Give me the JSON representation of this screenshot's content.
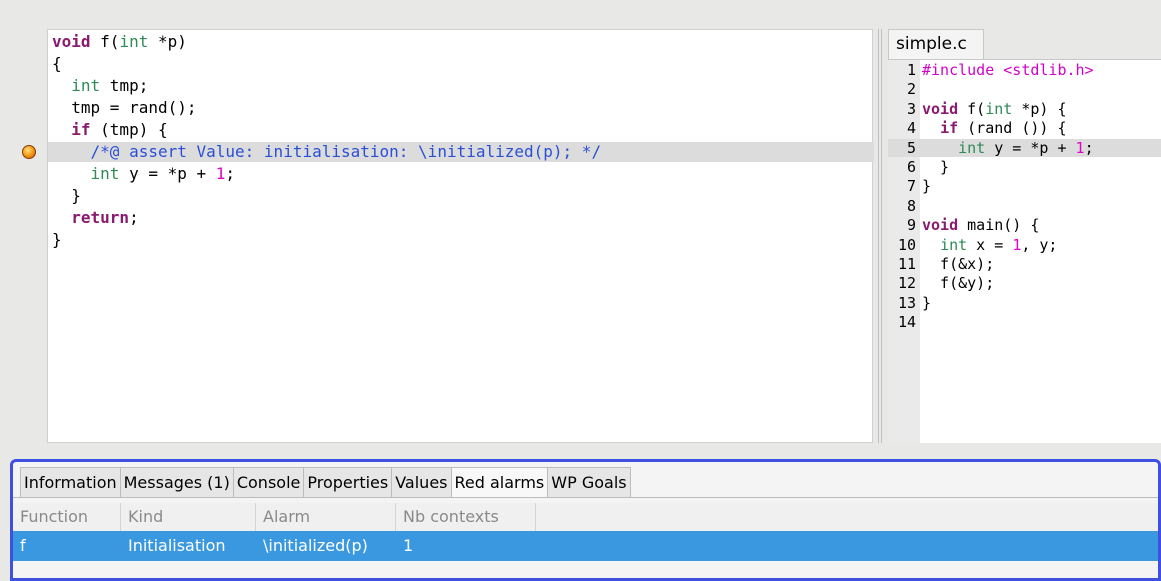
{
  "code_view": {
    "lines": [
      {
        "segments": [
          {
            "t": "void",
            "c": "kw"
          },
          {
            "t": " f(",
            "c": ""
          },
          {
            "t": "int",
            "c": "type"
          },
          {
            "t": " *p)",
            "c": ""
          }
        ]
      },
      {
        "segments": [
          {
            "t": "{",
            "c": ""
          }
        ]
      },
      {
        "segments": [
          {
            "t": "  ",
            "c": ""
          },
          {
            "t": "int",
            "c": "type"
          },
          {
            "t": " tmp;",
            "c": ""
          }
        ]
      },
      {
        "segments": [
          {
            "t": "  tmp = rand();",
            "c": ""
          }
        ]
      },
      {
        "segments": [
          {
            "t": "  ",
            "c": ""
          },
          {
            "t": "if",
            "c": "kw"
          },
          {
            "t": " (tmp) {",
            "c": ""
          }
        ]
      },
      {
        "segments": [
          {
            "t": "    /*@ assert Value: initialisation: \\initialized(p); */",
            "c": "comment"
          }
        ],
        "highlight": true,
        "alarm": true
      },
      {
        "segments": [
          {
            "t": "    ",
            "c": ""
          },
          {
            "t": "int",
            "c": "type"
          },
          {
            "t": " y = *p + ",
            "c": ""
          },
          {
            "t": "1",
            "c": "num"
          },
          {
            "t": ";",
            "c": ""
          }
        ]
      },
      {
        "segments": [
          {
            "t": "  }",
            "c": ""
          }
        ]
      },
      {
        "segments": [
          {
            "t": "  ",
            "c": ""
          },
          {
            "t": "return",
            "c": "kw"
          },
          {
            "t": ";",
            "c": ""
          }
        ]
      },
      {
        "segments": [
          {
            "t": "}",
            "c": ""
          }
        ]
      }
    ]
  },
  "source_view": {
    "tab_label": "simple.c",
    "lines": [
      {
        "n": "1",
        "segments": [
          {
            "t": "#include <stdlib.h>",
            "c": "pre"
          }
        ]
      },
      {
        "n": "2",
        "segments": []
      },
      {
        "n": "3",
        "segments": [
          {
            "t": "void",
            "c": "kw"
          },
          {
            "t": " f(",
            "c": ""
          },
          {
            "t": "int",
            "c": "type"
          },
          {
            "t": " *p) {",
            "c": ""
          }
        ]
      },
      {
        "n": "4",
        "segments": [
          {
            "t": "  ",
            "c": ""
          },
          {
            "t": "if",
            "c": "kw"
          },
          {
            "t": " (rand ()) {",
            "c": ""
          }
        ]
      },
      {
        "n": "5",
        "segments": [
          {
            "t": "    ",
            "c": ""
          },
          {
            "t": "int",
            "c": "type"
          },
          {
            "t": " y = *p + ",
            "c": ""
          },
          {
            "t": "1",
            "c": "num"
          },
          {
            "t": ";",
            "c": ""
          }
        ],
        "highlight": true
      },
      {
        "n": "6",
        "segments": [
          {
            "t": "  }",
            "c": ""
          }
        ]
      },
      {
        "n": "7",
        "segments": [
          {
            "t": "}",
            "c": ""
          }
        ]
      },
      {
        "n": "8",
        "segments": []
      },
      {
        "n": "9",
        "segments": [
          {
            "t": "void",
            "c": "kw"
          },
          {
            "t": " main() {",
            "c": ""
          }
        ]
      },
      {
        "n": "10",
        "segments": [
          {
            "t": "  ",
            "c": ""
          },
          {
            "t": "int",
            "c": "type"
          },
          {
            "t": " x = ",
            "c": ""
          },
          {
            "t": "1",
            "c": "num"
          },
          {
            "t": ", y;",
            "c": ""
          }
        ]
      },
      {
        "n": "11",
        "segments": [
          {
            "t": "  f(&x);",
            "c": ""
          }
        ]
      },
      {
        "n": "12",
        "segments": [
          {
            "t": "  f(&y);",
            "c": ""
          }
        ]
      },
      {
        "n": "13",
        "segments": [
          {
            "t": "}",
            "c": ""
          }
        ]
      },
      {
        "n": "14",
        "segments": []
      }
    ]
  },
  "bottom_tabs": [
    {
      "label": "Information"
    },
    {
      "label": "Messages (1)"
    },
    {
      "label": "Console"
    },
    {
      "label": "Properties"
    },
    {
      "label": "Values"
    },
    {
      "label": "Red alarms",
      "active": true
    },
    {
      "label": "WP Goals"
    }
  ],
  "alarms_table": {
    "columns": [
      "Function",
      "Kind",
      "Alarm",
      "Nb contexts"
    ],
    "rows": [
      [
        "f",
        "Initialisation",
        "\\initialized(p)",
        "1"
      ]
    ]
  },
  "colors": {
    "selection": "#3a98e0",
    "panel_border": "#3f4fe0",
    "keyword": "#8b1a6f",
    "type": "#2e8b57",
    "comment": "#2a4fd6",
    "number": "#e400c8"
  },
  "icons": {
    "alarm_marker": "red-alarm-bullet-icon"
  }
}
